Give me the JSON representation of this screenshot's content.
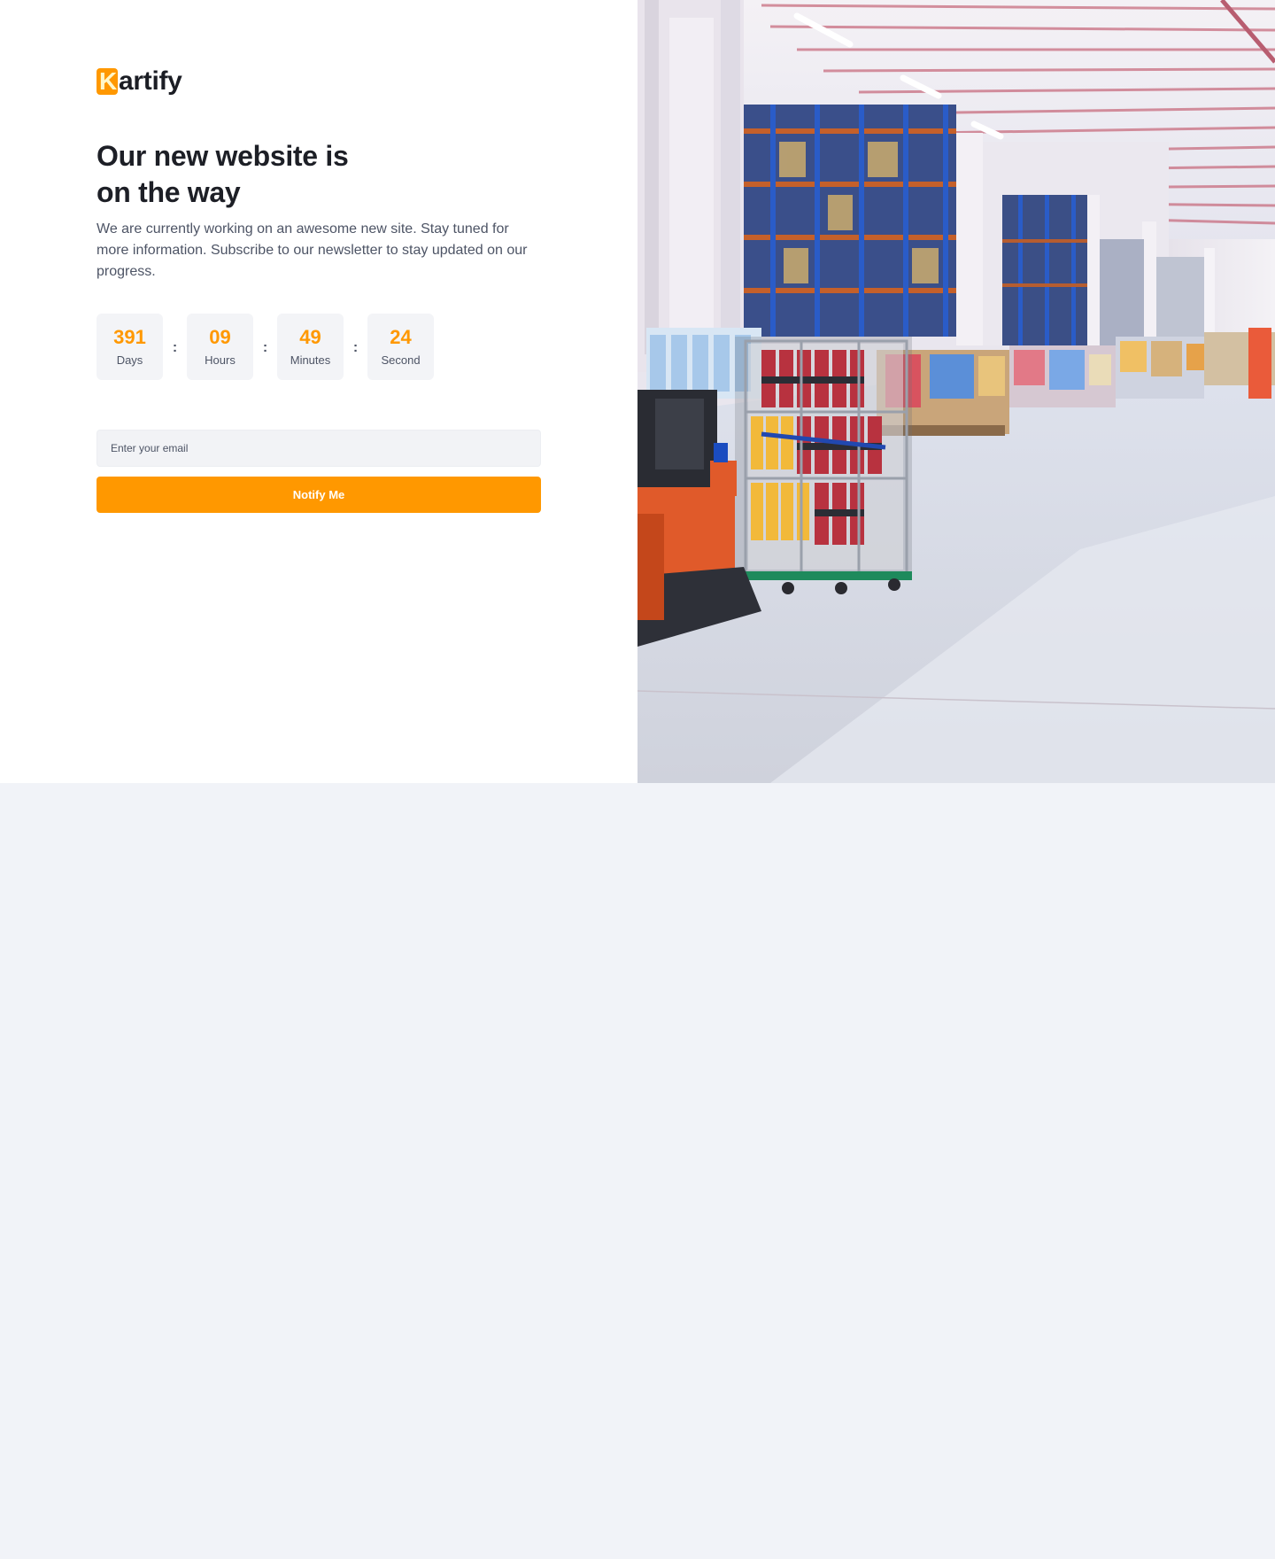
{
  "brand": {
    "logo_letter": "K",
    "logo_text": "artify",
    "accent_color": "#ff9800"
  },
  "hero": {
    "title_line1": "Our new website is",
    "title_line2": "on the way",
    "description": "We are currently working on an awesome new site. Stay tuned for more information. Subscribe to our newsletter to stay updated on our progress."
  },
  "countdown": {
    "days": {
      "value": "391",
      "label": "Days"
    },
    "hours": {
      "value": "09",
      "label": "Hours"
    },
    "minutes": {
      "value": "49",
      "label": "Minutes"
    },
    "seconds": {
      "value": "24",
      "label": "Second"
    },
    "separator": ":"
  },
  "subscribe": {
    "email_placeholder": "Enter your email",
    "button_label": "Notify Me"
  },
  "image": {
    "subject": "warehouse-photo"
  }
}
